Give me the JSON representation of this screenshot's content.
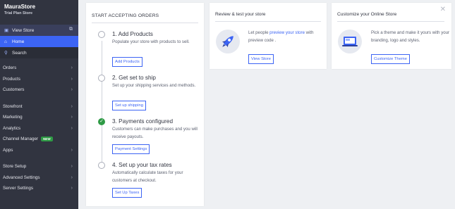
{
  "store": {
    "name": "MauraStore",
    "plan": "Trial Plan Store"
  },
  "nav_top": {
    "view_store": "View Store",
    "home": "Home",
    "search": "Search"
  },
  "nav_groups": [
    [
      "Orders",
      "Products",
      "Customers"
    ],
    [
      "Storefront",
      "Marketing",
      "Analytics",
      "Channel Manager",
      "Apps"
    ],
    [
      "Store Setup",
      "Advanced Settings",
      "Server Settings"
    ]
  ],
  "new_badge": "NEW",
  "checklist": {
    "title": "START ACCEPTING ORDERS",
    "steps": [
      {
        "title": "1. Add Products",
        "desc": "Populate your store with products to sell.",
        "button": "Add Products",
        "done": false
      },
      {
        "title": "2. Get set to ship",
        "desc": "Set up your shipping services and methods.",
        "button": "Set up shipping",
        "done": false
      },
      {
        "title": "3. Payments configured",
        "desc": "Customers can make purchases and you will receive payouts.",
        "button": "Payment Settings",
        "done": true
      },
      {
        "title": "4. Set up your tax rates",
        "desc": "Automatically calculate taxes for your customers at checkout.",
        "button": "Set Up Taxes",
        "done": false
      }
    ]
  },
  "review": {
    "title": "Review & test your store",
    "text_before": "Let people ",
    "link": "preview your store",
    "text_after": " with preview code .",
    "button": "View Store"
  },
  "customize": {
    "title": "Customize your Online Store",
    "text": "Pick a theme and make it yours with your branding, logo and styles.",
    "button": "Customize Theme"
  },
  "colors": {
    "sidebar": "#313440",
    "accent": "#3c64f4",
    "success": "#2e9a45",
    "background": "#eef0f3"
  },
  "icons": {
    "view_store": "storefront-icon",
    "home": "home-icon",
    "search": "search-icon",
    "external": "external-link-icon",
    "chevron": "chevron-right-icon",
    "check": "check-icon",
    "close": "close-icon",
    "rocket": "rocket-icon",
    "monitor": "monitor-icon"
  }
}
